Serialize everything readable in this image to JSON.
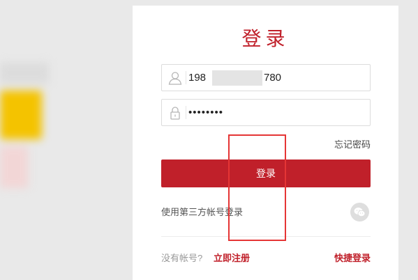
{
  "login": {
    "title": "登录",
    "username": {
      "value_prefix": "198",
      "value_suffix": "780",
      "icon": "user-icon"
    },
    "password": {
      "value": "••••••••",
      "icon": "lock-icon"
    },
    "forgot_password": "忘记密码",
    "submit": "登录",
    "third_party_label": "使用第三方帐号登录",
    "third_party_icon": "wechat-icon",
    "no_account": "没有帐号?",
    "register": "立即注册",
    "quick_login": "快捷登录"
  },
  "colors": {
    "accent": "#c0202a",
    "annotation": "#e53535",
    "background": "#e9e9e9"
  }
}
